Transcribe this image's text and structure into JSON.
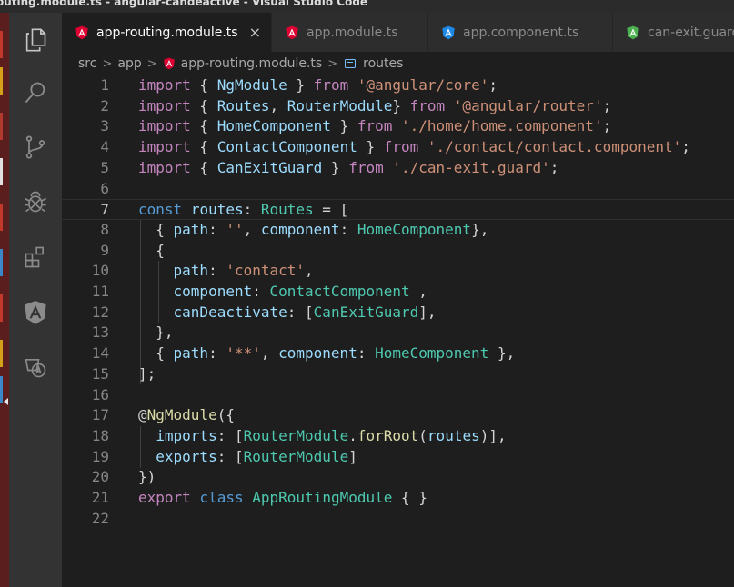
{
  "window": {
    "title": "outing.module.ts - angular-candeactive - Visual Studio Code"
  },
  "activity_bar": {
    "items": [
      {
        "name": "explorer",
        "icon": "files-icon"
      },
      {
        "name": "search",
        "icon": "search-icon"
      },
      {
        "name": "source-control",
        "icon": "source-control-icon"
      },
      {
        "name": "debug",
        "icon": "bug-icon"
      },
      {
        "name": "extensions",
        "icon": "extensions-icon"
      },
      {
        "name": "angular",
        "icon": "angular-icon"
      },
      {
        "name": "translate",
        "icon": "translate-icon"
      }
    ]
  },
  "tabs": [
    {
      "label": "app-routing.module.ts",
      "active": true,
      "icon": "angular-red-icon",
      "close": "×"
    },
    {
      "label": "app.module.ts",
      "active": false,
      "icon": "angular-red-icon"
    },
    {
      "label": "app.component.ts",
      "active": false,
      "icon": "angular-blue-icon"
    },
    {
      "label": "can-exit.guard",
      "active": false,
      "icon": "angular-green-icon"
    }
  ],
  "breadcrumb": {
    "parts": [
      "src",
      "app",
      "app-routing.module.ts",
      "routes"
    ],
    "separator": ">"
  },
  "editor": {
    "current_line": 7,
    "lines": [
      {
        "n": "1",
        "tokens": [
          [
            "kw",
            "import"
          ],
          [
            "pun",
            " { "
          ],
          [
            "var",
            "NgModule"
          ],
          [
            "pun",
            " } "
          ],
          [
            "kw",
            "from"
          ],
          [
            "pun",
            " "
          ],
          [
            "str",
            "'@angular/core'"
          ],
          [
            "pun",
            ";"
          ]
        ]
      },
      {
        "n": "2",
        "tokens": [
          [
            "kw",
            "import"
          ],
          [
            "pun",
            " { "
          ],
          [
            "var",
            "Routes"
          ],
          [
            "pun",
            ", "
          ],
          [
            "var",
            "RouterModule"
          ],
          [
            "pun",
            "} "
          ],
          [
            "kw",
            "from"
          ],
          [
            "pun",
            " "
          ],
          [
            "str",
            "'@angular/router'"
          ],
          [
            "pun",
            ";"
          ]
        ]
      },
      {
        "n": "3",
        "tokens": [
          [
            "kw",
            "import"
          ],
          [
            "pun",
            " { "
          ],
          [
            "var",
            "HomeComponent"
          ],
          [
            "pun",
            " } "
          ],
          [
            "kw",
            "from"
          ],
          [
            "pun",
            " "
          ],
          [
            "str",
            "'./home/home.component'"
          ],
          [
            "pun",
            ";"
          ]
        ]
      },
      {
        "n": "4",
        "tokens": [
          [
            "kw",
            "import"
          ],
          [
            "pun",
            " { "
          ],
          [
            "var",
            "ContactComponent"
          ],
          [
            "pun",
            " } "
          ],
          [
            "kw",
            "from"
          ],
          [
            "pun",
            " "
          ],
          [
            "str",
            "'./contact/contact.component'"
          ],
          [
            "pun",
            ";"
          ]
        ]
      },
      {
        "n": "5",
        "tokens": [
          [
            "kw",
            "import"
          ],
          [
            "pun",
            " { "
          ],
          [
            "var",
            "CanExitGuard"
          ],
          [
            "pun",
            " } "
          ],
          [
            "kw",
            "from"
          ],
          [
            "pun",
            " "
          ],
          [
            "str",
            "'./can-exit.guard'"
          ],
          [
            "pun",
            ";"
          ]
        ]
      },
      {
        "n": "6",
        "tokens": []
      },
      {
        "n": "7",
        "tokens": [
          [
            "kw2",
            "const"
          ],
          [
            "pun",
            " "
          ],
          [
            "var",
            "routes"
          ],
          [
            "pun",
            ": "
          ],
          [
            "type",
            "Routes"
          ],
          [
            "pun",
            " = "
          ],
          [
            "pun",
            "["
          ]
        ]
      },
      {
        "n": "8",
        "tokens": [
          [
            "pun",
            "  { "
          ],
          [
            "var",
            "path"
          ],
          [
            "pun",
            ": "
          ],
          [
            "str",
            "''"
          ],
          [
            "pun",
            ", "
          ],
          [
            "var",
            "component"
          ],
          [
            "pun",
            ": "
          ],
          [
            "type",
            "HomeComponent"
          ],
          [
            "pun",
            "},"
          ]
        ]
      },
      {
        "n": "9",
        "tokens": [
          [
            "pun",
            "  {"
          ]
        ]
      },
      {
        "n": "10",
        "tokens": [
          [
            "pun",
            "    "
          ],
          [
            "var",
            "path"
          ],
          [
            "pun",
            ": "
          ],
          [
            "str",
            "'contact'"
          ],
          [
            "pun",
            ","
          ]
        ]
      },
      {
        "n": "11",
        "tokens": [
          [
            "pun",
            "    "
          ],
          [
            "var",
            "component"
          ],
          [
            "pun",
            ": "
          ],
          [
            "type",
            "ContactComponent"
          ],
          [
            "pun",
            " ,"
          ]
        ]
      },
      {
        "n": "12",
        "tokens": [
          [
            "pun",
            "    "
          ],
          [
            "var",
            "canDeactivate"
          ],
          [
            "pun",
            ": ["
          ],
          [
            "type",
            "CanExitGuard"
          ],
          [
            "pun",
            "],"
          ]
        ]
      },
      {
        "n": "13",
        "tokens": [
          [
            "pun",
            "  },"
          ]
        ]
      },
      {
        "n": "14",
        "tokens": [
          [
            "pun",
            "  { "
          ],
          [
            "var",
            "path"
          ],
          [
            "pun",
            ": "
          ],
          [
            "str",
            "'**'"
          ],
          [
            "pun",
            ", "
          ],
          [
            "var",
            "component"
          ],
          [
            "pun",
            ": "
          ],
          [
            "type",
            "HomeComponent"
          ],
          [
            "pun",
            " },"
          ]
        ]
      },
      {
        "n": "15",
        "tokens": [
          [
            "pun",
            "];"
          ]
        ]
      },
      {
        "n": "16",
        "tokens": []
      },
      {
        "n": "17",
        "tokens": [
          [
            "pun",
            "@"
          ],
          [
            "fn",
            "NgModule"
          ],
          [
            "pun",
            "({"
          ]
        ]
      },
      {
        "n": "18",
        "tokens": [
          [
            "pun",
            "  "
          ],
          [
            "var",
            "imports"
          ],
          [
            "pun",
            ": ["
          ],
          [
            "type",
            "RouterModule"
          ],
          [
            "pun",
            "."
          ],
          [
            "fn",
            "forRoot"
          ],
          [
            "pun",
            "("
          ],
          [
            "var",
            "routes"
          ],
          [
            "pun",
            ")],"
          ]
        ]
      },
      {
        "n": "19",
        "tokens": [
          [
            "pun",
            "  "
          ],
          [
            "var",
            "exports"
          ],
          [
            "pun",
            ": ["
          ],
          [
            "type",
            "RouterModule"
          ],
          [
            "pun",
            "]"
          ]
        ]
      },
      {
        "n": "20",
        "tokens": [
          [
            "pun",
            "})"
          ]
        ]
      },
      {
        "n": "21",
        "tokens": [
          [
            "kw",
            "export"
          ],
          [
            "pun",
            " "
          ],
          [
            "kw2",
            "class"
          ],
          [
            "pun",
            " "
          ],
          [
            "type",
            "AppRoutingModule"
          ],
          [
            "pun",
            " { }"
          ]
        ]
      },
      {
        "n": "22",
        "tokens": []
      }
    ]
  },
  "colors": {
    "angular_red": "#dd0031",
    "angular_blue": "#1e88e5",
    "angular_green": "#4caf50"
  }
}
